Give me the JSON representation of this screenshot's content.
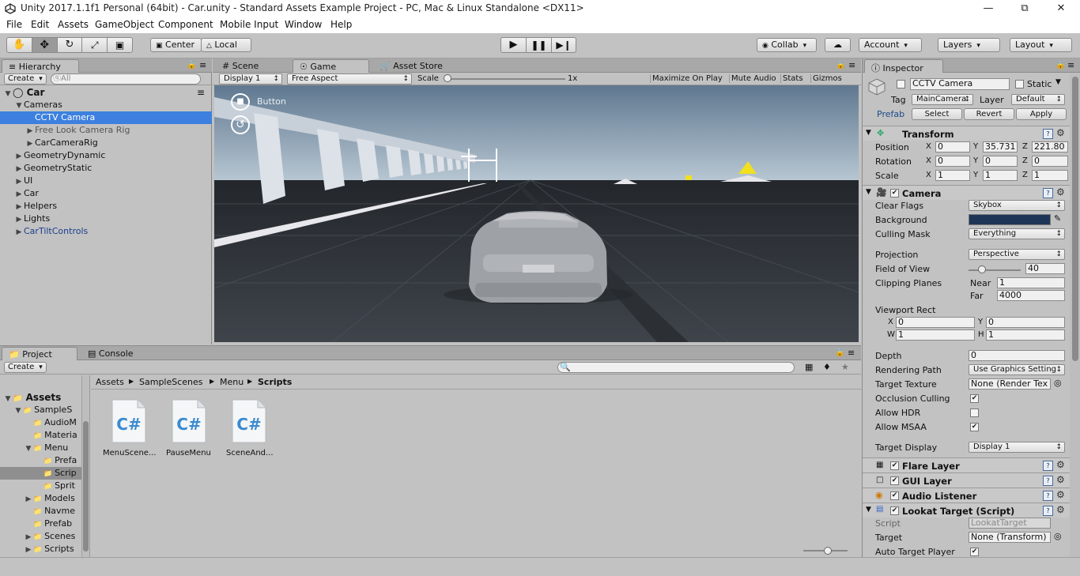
{
  "window": {
    "title": "Unity 2017.1.1f1 Personal (64bit) - Car.unity - Standard Assets Example Project - PC, Mac & Linux Standalone <DX11>",
    "minimize": "—",
    "maximize": "⧉",
    "close": "✕"
  },
  "menu": [
    "File",
    "Edit",
    "Assets",
    "GameObject",
    "Component",
    "Mobile Input",
    "Window",
    "Help"
  ],
  "toolbar": {
    "tools": [
      "hand-icon",
      "move-icon",
      "rotate-icon",
      "scale-icon",
      "rect-icon"
    ],
    "pivot": "Center",
    "space": "Local",
    "collab": "Collab",
    "account": "Account",
    "layers": "Layers",
    "layout": "Layout"
  },
  "hierarchy": {
    "tab": "Hierarchy",
    "create": "Create",
    "search": "ⓠAll",
    "scene": "Car",
    "items": [
      {
        "label": "Cameras",
        "indent": 1,
        "arrow": "▼"
      },
      {
        "label": "CCTV Camera",
        "indent": 2,
        "arrow": ""
      },
      {
        "label": "Free Look Camera Rig",
        "indent": 2,
        "arrow": "▶"
      },
      {
        "label": "CarCameraRig",
        "indent": 2,
        "arrow": "▶"
      },
      {
        "label": "GeometryDynamic",
        "indent": 1,
        "arrow": "▶"
      },
      {
        "label": "GeometryStatic",
        "indent": 1,
        "arrow": "▶"
      },
      {
        "label": "UI",
        "indent": 1,
        "arrow": "▶"
      },
      {
        "label": "Car",
        "indent": 1,
        "arrow": "▶"
      },
      {
        "label": "Helpers",
        "indent": 1,
        "arrow": "▶"
      },
      {
        "label": "Lights",
        "indent": 1,
        "arrow": "▶"
      },
      {
        "label": "CarTiltControls",
        "indent": 1,
        "arrow": "▶"
      }
    ]
  },
  "center_tabs": {
    "scene": "Scene",
    "game": "Game",
    "asset_store": "Asset Store"
  },
  "game_toolbar": {
    "display": "Display 1",
    "aspect": "Free Aspect",
    "scale_label": "Scale",
    "scale_value": "1x",
    "maximize": "Maximize On Play",
    "mute": "Mute Audio",
    "stats": "Stats",
    "gizmos": "Gizmos"
  },
  "game_view": {
    "button_label": "Button"
  },
  "project": {
    "tab": "Project",
    "console_tab": "Console",
    "create": "Create",
    "tree_top": "Assets",
    "tree": [
      {
        "label": "SampleS",
        "indent": 1,
        "arrow": "▼"
      },
      {
        "label": "AudioM",
        "indent": 2,
        "arrow": ""
      },
      {
        "label": "Materia",
        "indent": 2,
        "arrow": ""
      },
      {
        "label": "Menu",
        "indent": 2,
        "arrow": "▼"
      },
      {
        "label": "Prefa",
        "indent": 3,
        "arrow": ""
      },
      {
        "label": "Scrip",
        "indent": 3,
        "arrow": ""
      },
      {
        "label": "Sprit",
        "indent": 3,
        "arrow": ""
      },
      {
        "label": "Models",
        "indent": 2,
        "arrow": "▶"
      },
      {
        "label": "Navme",
        "indent": 2,
        "arrow": ""
      },
      {
        "label": "Prefab",
        "indent": 2,
        "arrow": ""
      },
      {
        "label": "Scenes",
        "indent": 2,
        "arrow": "▶"
      },
      {
        "label": "Scripts",
        "indent": 2,
        "arrow": "▶"
      }
    ],
    "breadcrumb": [
      "Assets",
      "SampleScenes",
      "Menu",
      "Scripts"
    ],
    "files": [
      "MenuScene...",
      "PauseMenu",
      "SceneAnd..."
    ],
    "file_glyph": "C#"
  },
  "inspector": {
    "tab": "Inspector",
    "object_name": "CCTV Camera",
    "static_label": "Static",
    "tag_label": "Tag",
    "tag_value": "MainCamera",
    "layer_label": "Layer",
    "layer_value": "Default",
    "prefab_label": "Prefab",
    "prefab_buttons": [
      "Select",
      "Revert",
      "Apply"
    ],
    "transform": {
      "title": "Transform",
      "rows": [
        {
          "label": "Position",
          "x": "0",
          "y": "35.731",
          "z": "221.80"
        },
        {
          "label": "Rotation",
          "x": "0",
          "y": "0",
          "z": "0"
        },
        {
          "label": "Scale",
          "x": "1",
          "y": "1",
          "z": "1"
        }
      ]
    },
    "camera": {
      "title": "Camera",
      "clear_flags_label": "Clear Flags",
      "clear_flags": "Skybox",
      "background_label": "Background",
      "background_color": "#1f3558",
      "culling_label": "Culling Mask",
      "culling": "Everything",
      "projection_label": "Projection",
      "projection": "Perspective",
      "fov_label": "Field of View",
      "fov": "40",
      "clipping_label": "Clipping Planes",
      "near_label": "Near",
      "near": "1",
      "far_label": "Far",
      "far": "4000",
      "viewport_label": "Viewport Rect",
      "vx": "0",
      "vy": "0",
      "vw": "1",
      "vh": "1",
      "depth_label": "Depth",
      "depth": "0",
      "rendering_label": "Rendering Path",
      "rendering": "Use Graphics Setting",
      "target_tex_label": "Target Texture",
      "target_tex": "None (Render Tex",
      "occlusion_label": "Occlusion Culling",
      "occlusion": true,
      "hdr_label": "Allow HDR",
      "hdr": false,
      "msaa_label": "Allow MSAA",
      "msaa": true,
      "target_display_label": "Target Display",
      "target_display": "Display 1"
    },
    "components": [
      "Flare Layer",
      "GUI Layer",
      "Audio Listener",
      "Lookat Target (Script)"
    ],
    "lookat": {
      "script_label": "Script",
      "script": "LookatTarget",
      "target_label": "Target",
      "target": "None (Transform)",
      "auto_label": "Auto Target Player",
      "auto": true
    }
  },
  "colors": {
    "accent": "#3d80df",
    "panel": "#c2c2c2",
    "sky": "#8aa3b8",
    "ground": "#3b3f45"
  }
}
